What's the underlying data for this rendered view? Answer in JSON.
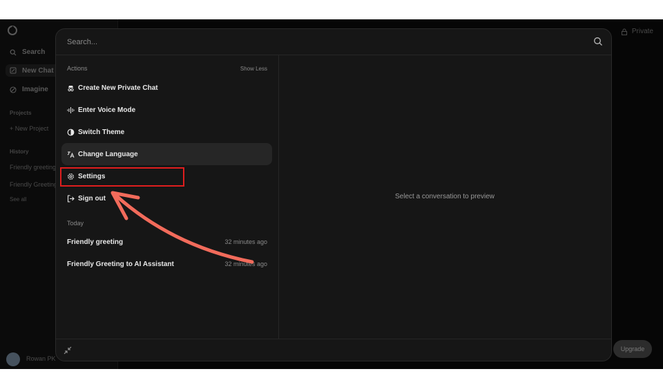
{
  "background": {
    "sidebar": {
      "items": [
        {
          "label": "Search",
          "icon": "search-icon"
        },
        {
          "label": "New Chat",
          "icon": "edit-icon"
        },
        {
          "label": "Imagine",
          "icon": "image-icon"
        }
      ],
      "projects_label": "Projects",
      "new_project_label": "New Project",
      "history_label": "History",
      "history_items": [
        "Friendly greeting",
        "Friendly Greeting"
      ],
      "see_all_label": "See all",
      "user_name": "Rowan PK"
    },
    "private_label": "Private",
    "upgrade_label": "Upgrade"
  },
  "search": {
    "placeholder": "Search..."
  },
  "actions": {
    "title": "Actions",
    "show_less_label": "Show Less",
    "items": [
      {
        "label": "Create New Private Chat",
        "icon": "incognito-icon"
      },
      {
        "label": "Enter Voice Mode",
        "icon": "voice-wave-icon"
      },
      {
        "label": "Switch Theme",
        "icon": "theme-icon"
      },
      {
        "label": "Change Language",
        "icon": "translate-icon"
      },
      {
        "label": "Settings",
        "icon": "gear-icon"
      },
      {
        "label": "Sign out",
        "icon": "sign-out-icon"
      }
    ]
  },
  "today": {
    "title": "Today",
    "conversations": [
      {
        "title": "Friendly greeting",
        "time": "32 minutes ago"
      },
      {
        "title": "Friendly Greeting to AI Assistant",
        "time": "32 minutes ago"
      }
    ]
  },
  "preview": {
    "empty_text": "Select a conversation to preview"
  },
  "colors": {
    "highlight": "#e01e1e",
    "arrow": "#f26b5b",
    "modal_bg": "#161616"
  }
}
